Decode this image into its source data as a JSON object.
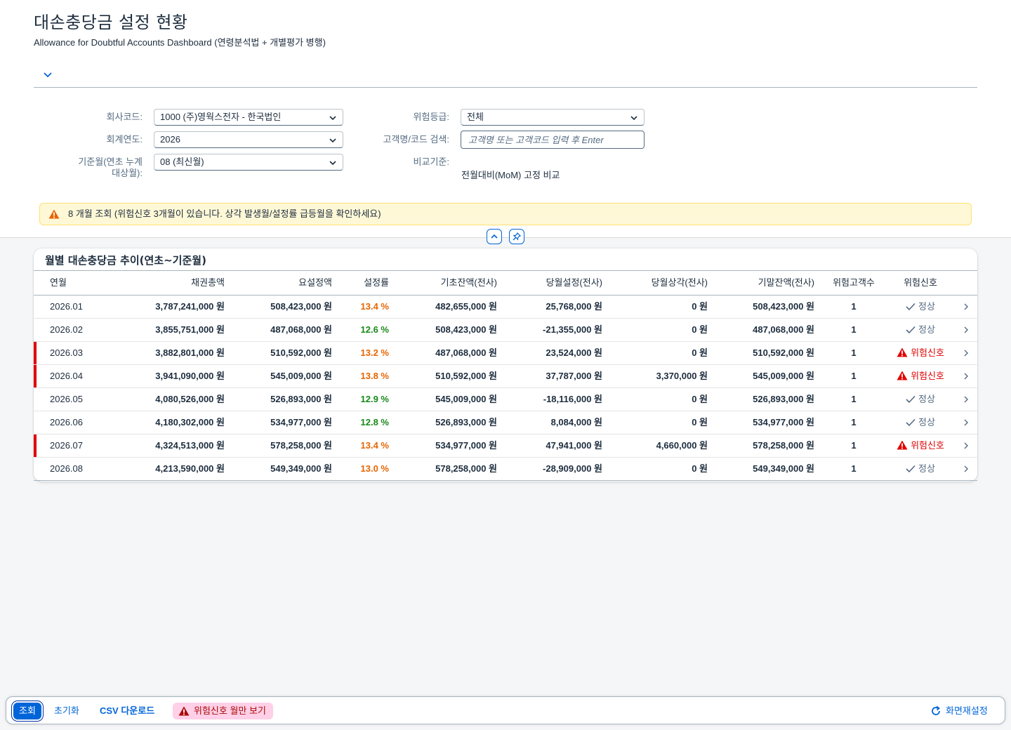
{
  "page": {
    "title": "대손충당금 설정 현황",
    "subtitle": "Allowance for Doubtful Accounts Dashboard (연령분석법 + 개별평가 병행)"
  },
  "filters": {
    "company_label": "회사코드:",
    "company_value": "1000 (주)영웍스전자 - 한국법인",
    "year_label": "회계연도:",
    "year_value": "2026",
    "month_label_line1": "기준월(연초 누계",
    "month_label_line2": "대상월):",
    "month_value": "08 (최신월)",
    "risk_label": "위험등급:",
    "risk_value": "전체",
    "search_label": "고객명/코드 검색:",
    "search_placeholder": "고객명 또는 고객코드 입력 후 Enter",
    "compare_label": "비교기준:",
    "compare_value": "전월대비(MoM) 고정 비교"
  },
  "warning": {
    "text": "8 개월 조회 (위험신호 3개월이 있습니다. 상각 발생월/설정률 급등월을 확인하세요)"
  },
  "table": {
    "title": "월별 대손충당금 추이(연초~기준월)",
    "columns": [
      "연월",
      "채권총액",
      "요설정액",
      "설정률",
      "기초잔액(전사)",
      "당월설정(전사)",
      "당월상각(전사)",
      "기말잔액(전사)",
      "위험고객수",
      "위험신호"
    ],
    "rows": [
      {
        "month": "2026.01",
        "receivable": "3,787,241,000 원",
        "required": "508,423,000 원",
        "rate": "13.4 %",
        "rate_level": "warn",
        "opening": "482,655,000 원",
        "provision": "25,768,000 원",
        "writeoff": "0 원",
        "closing": "508,423,000 원",
        "risk_customers": "1",
        "signal": "정상",
        "signal_level": "ok"
      },
      {
        "month": "2026.02",
        "receivable": "3,855,751,000 원",
        "required": "487,068,000 원",
        "rate": "12.6 %",
        "rate_level": "ok",
        "opening": "508,423,000 원",
        "provision": "-21,355,000 원",
        "writeoff": "0 원",
        "closing": "487,068,000 원",
        "risk_customers": "1",
        "signal": "정상",
        "signal_level": "ok"
      },
      {
        "month": "2026.03",
        "receivable": "3,882,801,000 원",
        "required": "510,592,000 원",
        "rate": "13.2 %",
        "rate_level": "warn",
        "opening": "487,068,000 원",
        "provision": "23,524,000 원",
        "writeoff": "0 원",
        "closing": "510,592,000 원",
        "risk_customers": "1",
        "signal": "위험신호",
        "signal_level": "bad"
      },
      {
        "month": "2026.04",
        "receivable": "3,941,090,000 원",
        "required": "545,009,000 원",
        "rate": "13.8 %",
        "rate_level": "warn",
        "opening": "510,592,000 원",
        "provision": "37,787,000 원",
        "writeoff": "3,370,000 원",
        "closing": "545,009,000 원",
        "risk_customers": "1",
        "signal": "위험신호",
        "signal_level": "bad"
      },
      {
        "month": "2026.05",
        "receivable": "4,080,526,000 원",
        "required": "526,893,000 원",
        "rate": "12.9 %",
        "rate_level": "ok",
        "opening": "545,009,000 원",
        "provision": "-18,116,000 원",
        "writeoff": "0 원",
        "closing": "526,893,000 원",
        "risk_customers": "1",
        "signal": "정상",
        "signal_level": "ok"
      },
      {
        "month": "2026.06",
        "receivable": "4,180,302,000 원",
        "required": "534,977,000 원",
        "rate": "12.8 %",
        "rate_level": "ok",
        "opening": "526,893,000 원",
        "provision": "8,084,000 원",
        "writeoff": "0 원",
        "closing": "534,977,000 원",
        "risk_customers": "1",
        "signal": "정상",
        "signal_level": "ok"
      },
      {
        "month": "2026.07",
        "receivable": "4,324,513,000 원",
        "required": "578,258,000 원",
        "rate": "13.4 %",
        "rate_level": "warn",
        "opening": "534,977,000 원",
        "provision": "47,941,000 원",
        "writeoff": "4,660,000 원",
        "closing": "578,258,000 원",
        "risk_customers": "1",
        "signal": "위험신호",
        "signal_level": "bad"
      },
      {
        "month": "2026.08",
        "receivable": "4,213,590,000 원",
        "required": "549,349,000 원",
        "rate": "13.0 %",
        "rate_level": "warn",
        "opening": "578,258,000 원",
        "provision": "-28,909,000 원",
        "writeoff": "0 원",
        "closing": "549,349,000 원",
        "risk_customers": "1",
        "signal": "정상",
        "signal_level": "ok"
      }
    ]
  },
  "footer": {
    "search_label": "조회",
    "reset_label": "초기화",
    "csv_label": "CSV 다운로드",
    "risk_only_label": "위험신호 월만 보기",
    "screen_reset_label": "화면재설정"
  },
  "colors": {
    "brand": "#0064d9",
    "danger": "#e00000",
    "warn": "#e76500",
    "ok": "#188918"
  }
}
